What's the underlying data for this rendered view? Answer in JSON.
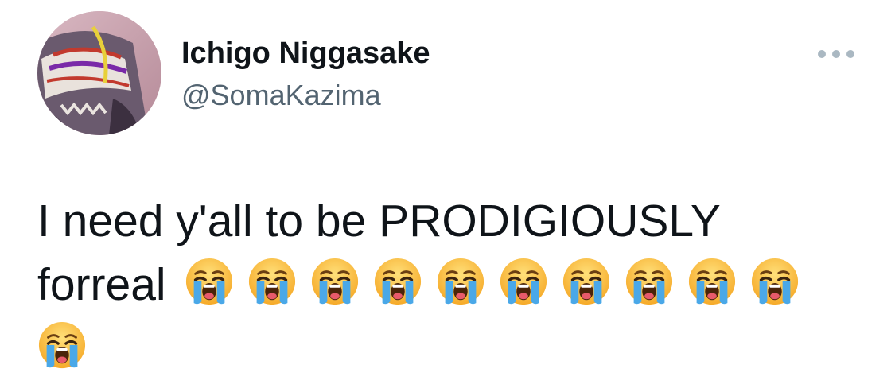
{
  "tweet": {
    "display_name": "Ichigo Niggasake",
    "handle": "@SomaKazima",
    "text_line1": "I need y'all to be PRODIGIOUSLY",
    "text_line2": "forreal",
    "emoji_name": "loudly-crying-face",
    "emoji_count": 11
  },
  "icons": {
    "more": "more-horizontal-icon"
  },
  "colors": {
    "name": "#0f1419",
    "handle": "#536471",
    "more_dots": "#aab8c2",
    "emoji_face": "#f9c13a",
    "emoji_tears": "#4aa8e8"
  }
}
